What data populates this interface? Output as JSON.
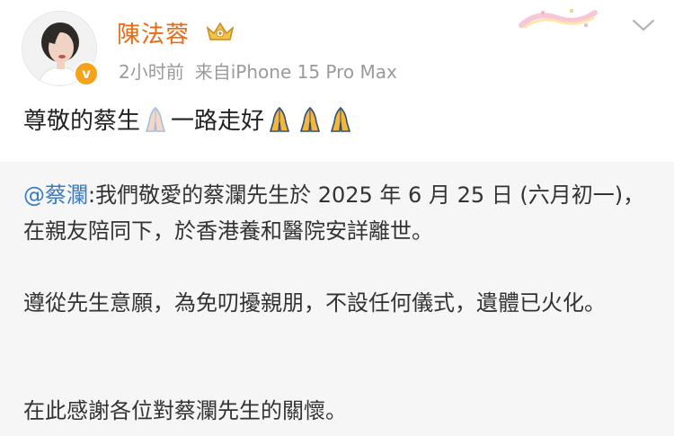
{
  "post": {
    "username": "陳法蓉",
    "time": "2小时前",
    "source": "来自iPhone 15 Pro Max",
    "text_before": "尊敬的蔡生",
    "text_after": "一路走好",
    "icons": {
      "avatar": "user-avatar",
      "verified": "verified-badge-icon",
      "vip": "crown-icon",
      "menu": "chevron-down-icon",
      "emoji": "folded-hands-emoji"
    },
    "colors": {
      "username": "#e86b16",
      "meta": "#9a9a9a",
      "mention": "#3b7bbf",
      "repost_bg": "#f6f6f6"
    }
  },
  "repost": {
    "mention": "@蔡瀾",
    "line1": ":我們敬愛的蔡瀾先生於 2025 年 6 月 25 日 (六月初一)，在親友陪同下，於香港養和醫院安詳離世。",
    "line2": "遵從先生意願，為免叨擾親朋，不設任何儀式，遺體已火化。",
    "line3": "在此感謝各位對蔡瀾先生的關懷。"
  }
}
